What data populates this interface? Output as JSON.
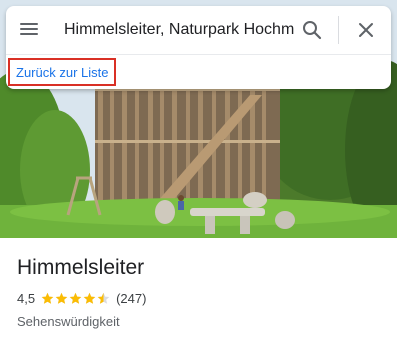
{
  "search": {
    "value": "Himmelsleiter, Naturpark Hochmoor"
  },
  "back_link": {
    "label": "Zurück zur Liste"
  },
  "place": {
    "name": "Himmelsleiter",
    "rating": "4,5",
    "rating_value": 4.5,
    "rating_max": 5,
    "review_count": "(247)",
    "category": "Sehenswürdigkeit"
  },
  "colors": {
    "link": "#1a73e8",
    "highlight_border": "#d93025",
    "star": "#fbbc04"
  },
  "icons": {
    "menu": "menu-icon",
    "search": "search-icon",
    "close": "close-icon",
    "star": "star-icon"
  }
}
